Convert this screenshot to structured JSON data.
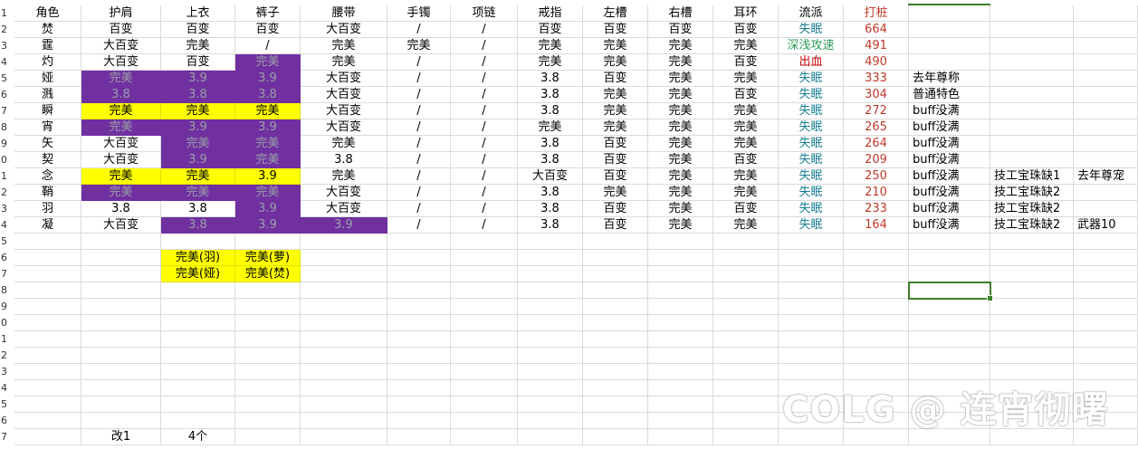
{
  "rows": [
    [
      "1",
      "角色",
      "护肩",
      "上衣",
      "裤子",
      "腰带",
      "手镯",
      "项链",
      "戒指",
      "左槽",
      "右槽",
      "耳环",
      "流派",
      "打桩",
      "",
      "",
      ""
    ],
    [
      "2",
      "焚",
      "百变",
      "百变",
      "百变",
      "大百变",
      "/",
      "/",
      "百变",
      "百变",
      "百变",
      "百变",
      "失眠",
      "664",
      "",
      "",
      ""
    ],
    [
      "3",
      "霆",
      "大百变",
      "完美",
      "/",
      "完美",
      "完美",
      "/",
      "完美",
      "完美",
      "完美",
      "完美",
      "深浅攻速",
      "491",
      "",
      "",
      ""
    ],
    [
      "4",
      "灼",
      "大百变",
      "百变",
      "完美",
      "完美",
      "/",
      "/",
      "完美",
      "完美",
      "完美",
      "百变",
      "出血",
      "490",
      "",
      "",
      ""
    ],
    [
      "5",
      "娅",
      "完美",
      "3.9",
      "3.9",
      "大百变",
      "/",
      "/",
      "3.8",
      "百变",
      "完美",
      "完美",
      "失眠",
      "333",
      "去年尊称",
      "",
      ""
    ],
    [
      "6",
      "溅",
      "3.8",
      "3.8",
      "3.8",
      "大百变",
      "/",
      "/",
      "3.8",
      "完美",
      "完美",
      "百变",
      "失眠",
      "304",
      "普通特色",
      "",
      ""
    ],
    [
      "7",
      "瞬",
      "完美",
      "完美",
      "完美",
      "大百变",
      "/",
      "/",
      "3.8",
      "完美",
      "完美",
      "完美",
      "失眠",
      "272",
      "buff没满",
      "",
      ""
    ],
    [
      "8",
      "宵",
      "完美",
      "3.9",
      "3.9",
      "大百变",
      "/",
      "/",
      "完美",
      "完美",
      "完美",
      "完美",
      "失眠",
      "265",
      "buff没满",
      "",
      ""
    ],
    [
      "9",
      "矢",
      "大百变",
      "完美",
      "完美",
      "完美",
      "/",
      "/",
      "3.8",
      "百变",
      "完美",
      "完美",
      "失眠",
      "264",
      "buff没满",
      "",
      ""
    ],
    [
      "0",
      "契",
      "大百变",
      "3.9",
      "完美",
      "3.8",
      "/",
      "/",
      "3.8",
      "百变",
      "完美",
      "百变",
      "失眠",
      "209",
      "buff没满",
      "",
      ""
    ],
    [
      "1",
      "念",
      "完美",
      "完美",
      "3.9",
      "完美",
      "/",
      "/",
      "大百变",
      "百变",
      "完美",
      "完美",
      "失眠",
      "250",
      "buff没满",
      "技工宝珠缺1",
      "去年尊宠"
    ],
    [
      "2",
      "鞘",
      "完美",
      "完美",
      "完美",
      "大百变",
      "/",
      "/",
      "3.8",
      "完美",
      "完美",
      "完美",
      "失眠",
      "210",
      "buff没满",
      "技工宝珠缺2",
      ""
    ],
    [
      "3",
      "羽",
      "3.8",
      "3.8",
      "3.9",
      "大百变",
      "/",
      "/",
      "3.8",
      "百变",
      "完美",
      "百变",
      "失眠",
      "233",
      "buff没满",
      "技工宝珠缺2",
      ""
    ],
    [
      "4",
      "凝",
      "大百变",
      "3.8",
      "3.9",
      "3.9",
      "/",
      "/",
      "3.8",
      "百变",
      "完美",
      "完美",
      "失眠",
      "164",
      "buff没满",
      "技工宝珠缺2",
      "武器10"
    ],
    [
      "5",
      "",
      "",
      "",
      "",
      "",
      "",
      "",
      "",
      "",
      "",
      "",
      "",
      "",
      "",
      "",
      ""
    ],
    [
      "6",
      "",
      "",
      "完美(羽)",
      "完美(萝)",
      "",
      "",
      "",
      "",
      "",
      "",
      "",
      "",
      "",
      "",
      "",
      ""
    ],
    [
      "7",
      "",
      "",
      "完美(娅)",
      "完美(焚)",
      "",
      "",
      "",
      "",
      "",
      "",
      "",
      "",
      "",
      "",
      "",
      ""
    ],
    [
      "8",
      "",
      "",
      "",
      "",
      "",
      "",
      "",
      "",
      "",
      "",
      "",
      "",
      "",
      "",
      "",
      ""
    ],
    [
      "9",
      "",
      "",
      "",
      "",
      "",
      "",
      "",
      "",
      "",
      "",
      "",
      "",
      "",
      "",
      "",
      ""
    ],
    [
      "0",
      "",
      "",
      "",
      "",
      "",
      "",
      "",
      "",
      "",
      "",
      "",
      "",
      "",
      "",
      "",
      ""
    ],
    [
      "1",
      "",
      "",
      "",
      "",
      "",
      "",
      "",
      "",
      "",
      "",
      "",
      "",
      "",
      "",
      "",
      ""
    ],
    [
      "2",
      "",
      "",
      "",
      "",
      "",
      "",
      "",
      "",
      "",
      "",
      "",
      "",
      "",
      "",
      "",
      ""
    ],
    [
      "3",
      "",
      "",
      "",
      "",
      "",
      "",
      "",
      "",
      "",
      "",
      "",
      "",
      "",
      "",
      "",
      ""
    ],
    [
      "4",
      "",
      "",
      "",
      "",
      "",
      "",
      "",
      "",
      "",
      "",
      "",
      "",
      "",
      "",
      "",
      ""
    ],
    [
      "5",
      "",
      "",
      "",
      "",
      "",
      "",
      "",
      "",
      "",
      "",
      "",
      "",
      "",
      "",
      "",
      ""
    ],
    [
      "6",
      "",
      "",
      "",
      "",
      "",
      "",
      "",
      "",
      "",
      "",
      "",
      "",
      "",
      "",
      "",
      ""
    ],
    [
      "7",
      "",
      "",
      "",
      "",
      "",
      "",
      "",
      "",
      "",
      "",
      "",
      "",
      "",
      "",
      "",
      ""
    ],
    [
      "",
      "",
      "改1",
      "4个",
      "",
      "",
      "",
      "",
      "",
      "",
      "",
      "",
      "",
      "",
      "",
      "",
      ""
    ]
  ],
  "fills": {
    "purple": "#7030a0",
    "yellow": "#ffff00"
  },
  "text_colors": {
    "teal": "#1a7f95",
    "green": "#2f9a5b",
    "red": "#c00000",
    "score_red": "#c0392b"
  },
  "watermark": "COLG @ 连宵彻曙"
}
